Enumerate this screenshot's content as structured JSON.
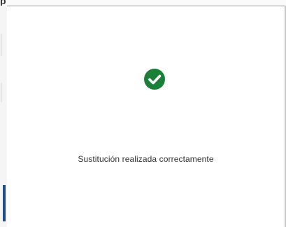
{
  "background_strip": {
    "title_fragment": "p"
  },
  "dialog": {
    "status_icon": "check-circle-icon",
    "status_color": "#1a7f37",
    "message": "Sustitución realizada correctamente"
  },
  "colors": {
    "accent": "#1f4e8c",
    "success": "#1a7f37"
  }
}
